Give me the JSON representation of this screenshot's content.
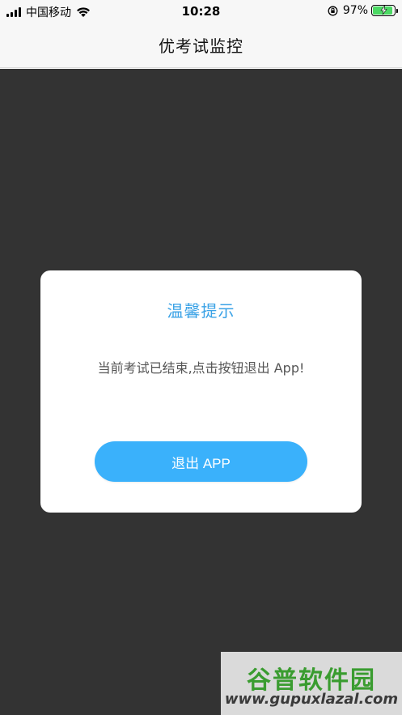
{
  "status_bar": {
    "carrier": "中国移动",
    "time": "10:28",
    "battery_percent": "97%",
    "battery_level": 0.97,
    "battery_color": "#4cd964",
    "icons": [
      "signal-icon",
      "wifi-icon",
      "orientation-lock-icon",
      "battery-icon",
      "charging-bolt-icon"
    ]
  },
  "nav": {
    "title": "优考试监控"
  },
  "dialog": {
    "title": "温馨提示",
    "message": "当前考试已结束,点击按钮退出 App!",
    "button_label": "退出 APP",
    "title_color": "#3aa2e6",
    "button_color": "#3ab1fb"
  },
  "overlay": {
    "color": "#333333"
  },
  "watermark": {
    "logo_text": "谷普软件园",
    "url": "www.gupuxlazal.com"
  }
}
